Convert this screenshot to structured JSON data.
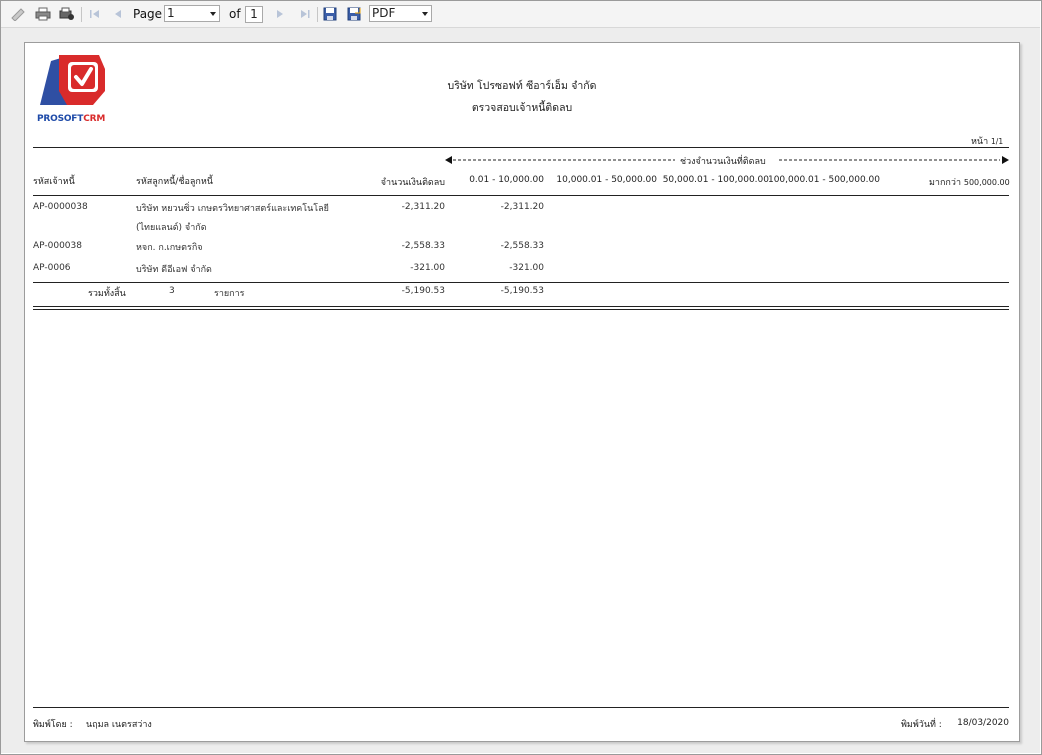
{
  "toolbar": {
    "page_label": "Page",
    "page_value": "1",
    "of_label": "of",
    "page_total": "1",
    "export_format": "PDF",
    "icons": [
      "edit-icon",
      "print-icon",
      "print-setup-icon",
      "first-page-icon",
      "prev-page-icon",
      "next-page-icon",
      "last-page-icon",
      "save-icon",
      "save-as-icon"
    ]
  },
  "report": {
    "logo_text_1": "PROSOFT",
    "logo_text_2": "CRM",
    "company": "บริษัท โปรซอฟท์ ซีอาร์เอ็ม จำกัด",
    "title": "ตรวจสอบเจ้าหนี้ติดลบ",
    "page_label": "หน้า",
    "page_value": "1/1",
    "range_caption": "ช่วงจำนวนเงินที่ติดลบ",
    "columns": {
      "creditor_code": "รหัสเจ้าหนี้",
      "debtor": "รหัสลูกหนี้/ชื่อลูกหนี้",
      "amount": "จำนวนเงินติดลบ",
      "r1": "0.01 - 10,000.00",
      "r2": "10,000.01 - 50,000.00",
      "r3": "50,000.01 - 100,000.00",
      "r4": "100,000.01 - 500,000.00",
      "r5_prefix": "มากกว่า",
      "r5_value": "500,000.00"
    },
    "rows": [
      {
        "code": "AP-0000038",
        "name": "บริษัท หยวนซิ่ว เกษตรวิทยาศาสตร์และเทคโนโลยี",
        "name2": "(ไทยแลนด์) จำกัด",
        "amount": "-2,311.20",
        "r1": "-2,311.20"
      },
      {
        "code": "AP-000038",
        "name": "หจก. ก.เกษตรกิจ",
        "amount": "-2,558.33",
        "r1": "-2,558.33"
      },
      {
        "code": "AP-0006",
        "name": "บริษัท ดีอีเอฟ จำกัด",
        "amount": "-321.00",
        "r1": "-321.00"
      }
    ],
    "total": {
      "label": "รวมทั้งสิ้น",
      "count": "3",
      "unit": "รายการ",
      "amount": "-5,190.53",
      "r1": "-5,190.53"
    },
    "footer": {
      "printed_by_label": "พิมพ์โดย :",
      "printed_by": "นฤมล เนตรสว่าง",
      "printed_date_label": "พิมพ์วันที่ :",
      "printed_date": "18/03/2020"
    }
  },
  "colors": {
    "logo_red": "#d92b2b",
    "logo_blue": "#2f4fa3",
    "logo_text": "#1e4aa8"
  }
}
